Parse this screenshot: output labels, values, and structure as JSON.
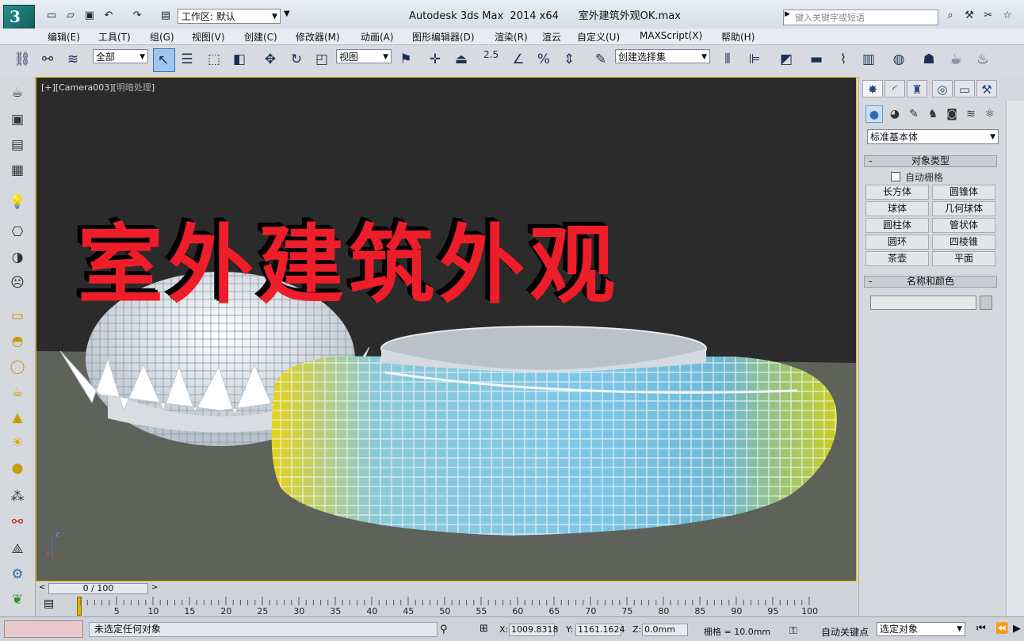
{
  "window": {
    "title": "Autodesk 3ds Max  2014 x64      室外建筑外观OK.max",
    "workspace_value": "工作区: 默认",
    "search_placeholder": "键入关键字或短语"
  },
  "menu": [
    "编辑(E)",
    "工具(T)",
    "组(G)",
    "视图(V)",
    "创建(C)",
    "修改器(M)",
    "动画(A)",
    "图形编辑器(D)",
    "渲染(R)",
    "渲云",
    "自定义(U)",
    "MAXScript(X)",
    "帮助(H)"
  ],
  "toolbar": {
    "filter_value": "全部",
    "coord_value": "视图",
    "snap_angle_label": "2.5",
    "named_selection_value": "创建选择集"
  },
  "viewport": {
    "label": "[+][Camera003][",
    "shading_label": "明暗处理",
    "label_end": "]",
    "overlay_title": "室外建筑外观"
  },
  "command_panel": {
    "category_value": "标准基本体",
    "object_type_header": "对象类型",
    "autogrid_label": "自动栅格",
    "object_buttons": [
      "长方体",
      "圆锥体",
      "球体",
      "几何球体",
      "圆柱体",
      "管状体",
      "圆环",
      "四棱锥",
      "茶壶",
      "平面"
    ],
    "name_color_header": "名称和颜色"
  },
  "timeline": {
    "frame_label": "0 / 100",
    "ticks": [
      "5",
      "10",
      "15",
      "20",
      "25",
      "30",
      "35",
      "40",
      "45",
      "50",
      "55",
      "60",
      "65",
      "70",
      "75",
      "80",
      "85",
      "90",
      "95",
      "100"
    ]
  },
  "status": {
    "message": "未选定任何对象",
    "x_label": "X:",
    "x_value": "1009.8318",
    "y_label": "Y:",
    "y_value": "1161.1624",
    "z_label": "Z:",
    "z_value": "0.0mm",
    "grid_label": "栅格 = 10.0mm",
    "autokey_label": "自动关键点",
    "selection_value": "选定对象"
  },
  "colors": {
    "overlay_title": "#ee1d2a",
    "viewport_bg": "#2b2b2b",
    "active_border": "#f0c000"
  }
}
